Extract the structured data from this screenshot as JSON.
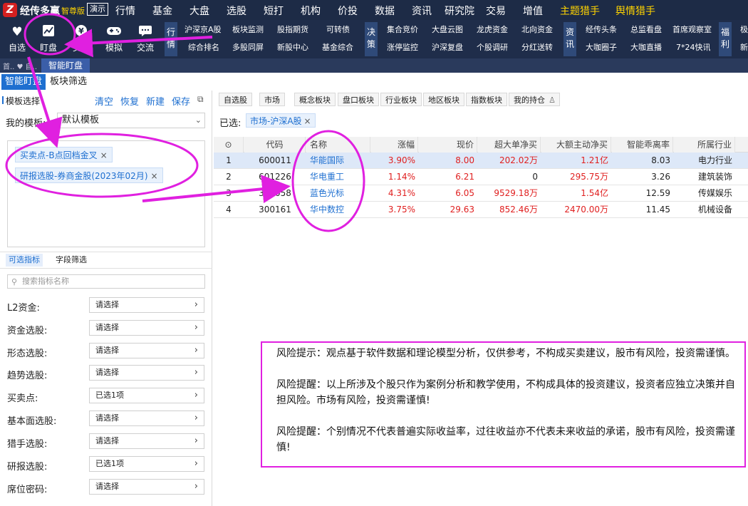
{
  "app": {
    "logo_glyph": "Z",
    "name": "经传多赢",
    "edition": "智尊版",
    "demo_badge": "演示"
  },
  "menu": [
    "行情",
    "基金",
    "大盘",
    "选股",
    "短打",
    "机构",
    "价投",
    "数据",
    "资讯",
    "研究院",
    "交易",
    "增值",
    "主题猎手",
    "舆情猎手"
  ],
  "toolbar": {
    "buttons": [
      {
        "label": "自选",
        "icon": "heart-icon"
      },
      {
        "label": "盯盘",
        "icon": "chart-monitor-icon"
      },
      {
        "label": "交易",
        "icon": "yuan-exchange-icon"
      },
      {
        "label": "模拟",
        "icon": "gamepad-icon"
      },
      {
        "label": "交流",
        "icon": "chat-icon"
      }
    ],
    "sections": [
      {
        "label": "行情",
        "links": [
          "沪深京A股",
          "板块监测",
          "股指期货",
          "可转债",
          "综合排名",
          "多股同屏",
          "新股中心",
          "基金综合"
        ]
      },
      {
        "label": "决策",
        "links": [
          "集合竞价",
          "大盘云图",
          "龙虎资金",
          "北向资金",
          "涨停监控",
          "沪深复盘",
          "个股调研",
          "分红送转"
        ]
      },
      {
        "label": "资讯",
        "links": [
          "经传头条",
          "总监看盘",
          "首席观察室",
          "大咖圈子",
          "大咖直播",
          "7*24快讯"
        ]
      },
      {
        "label": "福利",
        "links": [
          "极",
          "新"
        ]
      }
    ]
  },
  "tabstrip": {
    "crumb": "首.. ♥ 自..",
    "active_tab": "智能盯盘"
  },
  "subtabs": [
    "智能盯盘",
    "板块筛选"
  ],
  "left": {
    "template_title": "模板选择",
    "actions": [
      "清空",
      "恢复",
      "新建",
      "保存"
    ],
    "my_template_label": "我的模板:",
    "my_template_value": "默认模板",
    "tags": [
      "买卖点-B点回档金叉",
      "研报选股-券商金股(2023年02月)"
    ],
    "filter_tabs": [
      "可选指标",
      "字段筛选"
    ],
    "search_placeholder": "搜索指标名称",
    "filters": [
      {
        "label": "L2资金:",
        "value": "请选择"
      },
      {
        "label": "资金选股:",
        "value": "请选择"
      },
      {
        "label": "形态选股:",
        "value": "请选择"
      },
      {
        "label": "趋势选股:",
        "value": "请选择"
      },
      {
        "label": "买卖点:",
        "value": "已选1项"
      },
      {
        "label": "基本面选股:",
        "value": "请选择"
      },
      {
        "label": "猎手选股:",
        "value": "请选择"
      },
      {
        "label": "研报选股:",
        "value": "已选1项"
      },
      {
        "label": "席位密码:",
        "value": "请选择"
      }
    ]
  },
  "right": {
    "filter_buttons": [
      "自选股",
      "市场",
      "概念板块",
      "盘口板块",
      "行业板块",
      "地区板块",
      "指数板块",
      "我的持仓"
    ],
    "selected_label": "已选:",
    "selected_tag": "市场-沪深A股",
    "columns": [
      "代码",
      "名称",
      "涨幅",
      "现价",
      "超大单净买",
      "大额主动净买",
      "智能乖离率",
      "所属行业"
    ],
    "rows": [
      {
        "idx": "1",
        "code": "600011",
        "name": "华能国际",
        "change": "3.90%",
        "price": "8.00",
        "super_net": "202.02万",
        "big_net": "1.21亿",
        "bias": "8.03",
        "industry": "电力行业"
      },
      {
        "idx": "2",
        "code": "601226",
        "name": "华电重工",
        "change": "1.14%",
        "price": "6.21",
        "super_net": "0",
        "big_net": "295.75万",
        "bias": "3.26",
        "industry": "建筑装饰"
      },
      {
        "idx": "3",
        "code": "300058",
        "name": "蓝色光标",
        "change": "4.31%",
        "price": "6.05",
        "super_net": "9529.18万",
        "big_net": "1.54亿",
        "bias": "12.59",
        "industry": "传媒娱乐"
      },
      {
        "idx": "4",
        "code": "300161",
        "name": "华中数控",
        "change": "3.75%",
        "price": "29.63",
        "super_net": "852.46万",
        "big_net": "2470.00万",
        "bias": "11.45",
        "industry": "机械设备"
      }
    ]
  },
  "risk": [
    "风险提示：观点基于软件数据和理论模型分析，仅供参考，不构成买卖建议，股市有风险，投资需谨慎。",
    "风险提醒：以上所涉及个股只作为案例分析和教学使用，不构成具体的投资建议，投资者应独立决策并自担风险。市场有风险，投资需谨慎!",
    "风险提醒：个别情况不代表普遍实际收益率，过往收益亦不代表未来收益的承诺，股市有风险，投资需谨慎!"
  ],
  "colors": {
    "menubar": "#1d2b46",
    "accent": "#1e6fd0",
    "up_red": "#e02020",
    "annotation": "#e020e0"
  }
}
